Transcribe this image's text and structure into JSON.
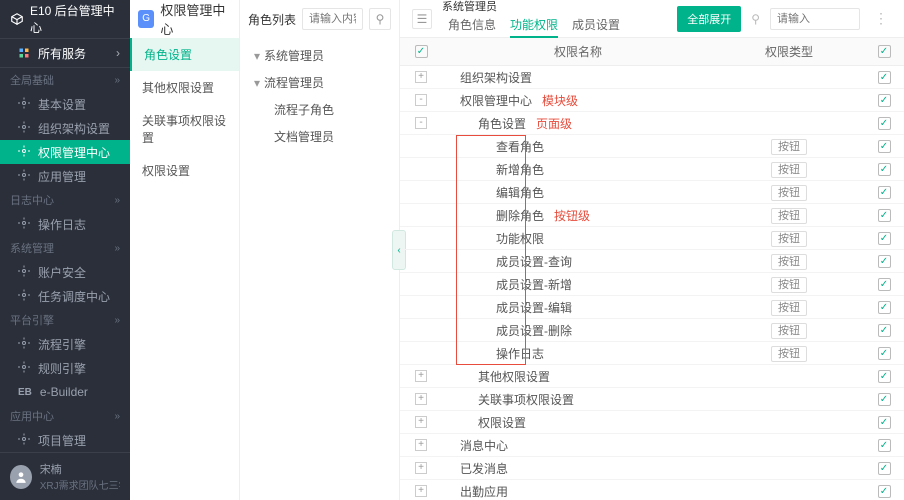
{
  "brand": "E10 后台管理中心",
  "allServices": "所有服务",
  "sbGroups": [
    {
      "label": "全局基础",
      "items": [
        {
          "label": "基本设置"
        },
        {
          "label": "组织架构设置"
        },
        {
          "label": "权限管理中心",
          "active": true
        },
        {
          "label": "应用管理"
        }
      ]
    },
    {
      "label": "日志中心",
      "items": [
        {
          "label": "操作日志"
        }
      ]
    },
    {
      "label": "系统管理",
      "items": [
        {
          "label": "账户安全"
        },
        {
          "label": "任务调度中心"
        }
      ]
    },
    {
      "label": "平台引擎",
      "items": [
        {
          "label": "流程引擎"
        },
        {
          "label": "规则引擎"
        },
        {
          "label": "e-Builder",
          "prefix": "EB"
        }
      ]
    },
    {
      "label": "应用中心",
      "items": [
        {
          "label": "项目管理"
        }
      ]
    }
  ],
  "user": {
    "name": "宋楠",
    "team": "XRJ需求团队七三零"
  },
  "col2": {
    "title": "权限管理中心",
    "items": [
      {
        "label": "角色设置",
        "active": true
      },
      {
        "label": "其他权限设置"
      },
      {
        "label": "关联事项权限设置"
      },
      {
        "label": "权限设置"
      }
    ]
  },
  "col3": {
    "label": "角色列表",
    "placeholder": "请输入内容",
    "tree": [
      {
        "label": "系统管理员",
        "lvl": 1,
        "exp": "-"
      },
      {
        "label": "流程管理员",
        "lvl": 1,
        "exp": "-"
      },
      {
        "label": "流程子角色",
        "lvl": 2
      },
      {
        "label": "文档管理员",
        "lvl": 2
      }
    ]
  },
  "main": {
    "crumb1": "系统管理员",
    "tabs": [
      {
        "label": "角色信息"
      },
      {
        "label": "功能权限",
        "active": true
      },
      {
        "label": "成员设置"
      }
    ],
    "expandAll": "全部展开",
    "searchPh": "请输入",
    "th": {
      "name": "权限名称",
      "type": "权限类型"
    },
    "ann": {
      "module": "模块级",
      "page": "页面级",
      "button": "按钮级"
    },
    "rows": [
      {
        "indent": 60,
        "exp": "+",
        "label": "组织架构设置",
        "type": ""
      },
      {
        "indent": 60,
        "exp": "-",
        "label": "权限管理中心",
        "type": "",
        "ann": "module"
      },
      {
        "indent": 78,
        "exp": "-",
        "label": "角色设置",
        "type": "",
        "ann": "page"
      },
      {
        "indent": 96,
        "label": "查看角色",
        "type": "按钮"
      },
      {
        "indent": 96,
        "label": "新增角色",
        "type": "按钮"
      },
      {
        "indent": 96,
        "label": "编辑角色",
        "type": "按钮"
      },
      {
        "indent": 96,
        "label": "删除角色",
        "type": "按钮",
        "ann": "button"
      },
      {
        "indent": 96,
        "label": "功能权限",
        "type": "按钮"
      },
      {
        "indent": 96,
        "label": "成员设置-查询",
        "type": "按钮"
      },
      {
        "indent": 96,
        "label": "成员设置-新增",
        "type": "按钮"
      },
      {
        "indent": 96,
        "label": "成员设置-编辑",
        "type": "按钮"
      },
      {
        "indent": 96,
        "label": "成员设置-删除",
        "type": "按钮"
      },
      {
        "indent": 96,
        "label": "操作日志",
        "type": "按钮"
      },
      {
        "indent": 78,
        "exp": "+",
        "label": "其他权限设置",
        "type": ""
      },
      {
        "indent": 78,
        "exp": "+",
        "label": "关联事项权限设置",
        "type": ""
      },
      {
        "indent": 78,
        "exp": "+",
        "label": "权限设置",
        "type": ""
      },
      {
        "indent": 60,
        "exp": "+",
        "label": "消息中心",
        "type": ""
      },
      {
        "indent": 60,
        "exp": "+",
        "label": "已发消息",
        "type": ""
      },
      {
        "indent": 60,
        "exp": "+",
        "label": "出勤应用",
        "type": ""
      }
    ]
  }
}
